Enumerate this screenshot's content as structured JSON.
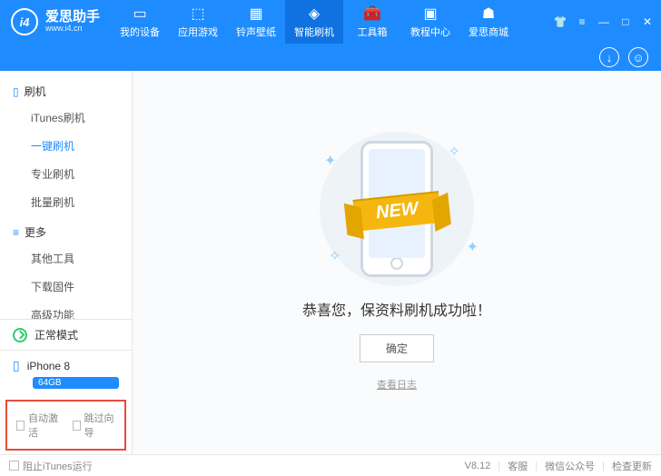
{
  "header": {
    "logo_mark": "i4",
    "logo_cn": "爱思助手",
    "logo_en": "www.i4.cn",
    "nav": [
      {
        "label": "我的设备"
      },
      {
        "label": "应用游戏"
      },
      {
        "label": "铃声壁纸"
      },
      {
        "label": "智能刷机"
      },
      {
        "label": "工具箱"
      },
      {
        "label": "教程中心"
      },
      {
        "label": "爱思商城"
      }
    ]
  },
  "sidebar": {
    "groups": [
      {
        "title": "刷机",
        "items": [
          {
            "label": "iTunes刷机"
          },
          {
            "label": "一键刷机",
            "active": true
          },
          {
            "label": "专业刷机"
          },
          {
            "label": "批量刷机"
          }
        ]
      },
      {
        "title": "更多",
        "items": [
          {
            "label": "其他工具"
          },
          {
            "label": "下载固件"
          },
          {
            "label": "高级功能"
          }
        ]
      }
    ],
    "mode": "正常模式",
    "device": {
      "name": "iPhone 8",
      "storage": "64GB"
    },
    "options": [
      {
        "label": "自动激活"
      },
      {
        "label": "跳过向导"
      }
    ]
  },
  "main": {
    "ribbon": "NEW",
    "success": "恭喜您，保资料刷机成功啦！",
    "ok": "确定",
    "log": "查看日志"
  },
  "footer": {
    "block_itunes": "阻止iTunes运行",
    "version": "V8.12",
    "links": [
      "客服",
      "微信公众号",
      "检查更新"
    ]
  }
}
